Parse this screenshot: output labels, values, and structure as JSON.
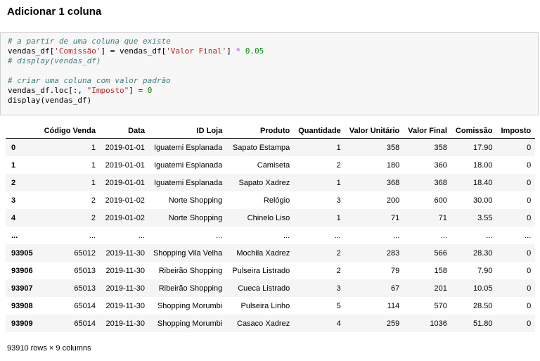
{
  "heading": "Adicionar 1 coluna",
  "code_lines": [
    {
      "type": "comment",
      "text": "# a partir de uma coluna que existe"
    },
    {
      "type": "code",
      "parts": [
        {
          "t": "plain",
          "v": "vendas_df["
        },
        {
          "t": "str",
          "v": "'Comissão'"
        },
        {
          "t": "plain",
          "v": "] = vendas_df["
        },
        {
          "t": "str",
          "v": "'Valor Final'"
        },
        {
          "t": "plain",
          "v": "] "
        },
        {
          "t": "op",
          "v": "*"
        },
        {
          "t": "plain",
          "v": " "
        },
        {
          "t": "num",
          "v": "0.05"
        }
      ]
    },
    {
      "type": "comment",
      "text": "# display(vendas_df)"
    },
    {
      "type": "blank",
      "text": ""
    },
    {
      "type": "comment",
      "text": "# criar uma coluna com valor padrão"
    },
    {
      "type": "code",
      "parts": [
        {
          "t": "plain",
          "v": "vendas_df.loc[:, "
        },
        {
          "t": "str",
          "v": "\"Imposto\""
        },
        {
          "t": "plain",
          "v": "] = "
        },
        {
          "t": "num",
          "v": "0"
        }
      ]
    },
    {
      "type": "code",
      "parts": [
        {
          "t": "plain",
          "v": "display(vendas_df)"
        }
      ]
    }
  ],
  "table": {
    "columns": [
      "",
      "Código Venda",
      "Data",
      "ID Loja",
      "Produto",
      "Quantidade",
      "Valor Unitário",
      "Valor Final",
      "Comissão",
      "Imposto"
    ],
    "rows": [
      [
        "0",
        "1",
        "2019-01-01",
        "Iguatemi Esplanada",
        "Sapato Estampa",
        "1",
        "358",
        "358",
        "17.90",
        "0"
      ],
      [
        "1",
        "1",
        "2019-01-01",
        "Iguatemi Esplanada",
        "Camiseta",
        "2",
        "180",
        "360",
        "18.00",
        "0"
      ],
      [
        "2",
        "1",
        "2019-01-01",
        "Iguatemi Esplanada",
        "Sapato Xadrez",
        "1",
        "368",
        "368",
        "18.40",
        "0"
      ],
      [
        "3",
        "2",
        "2019-01-02",
        "Norte Shopping",
        "Relógio",
        "3",
        "200",
        "600",
        "30.00",
        "0"
      ],
      [
        "4",
        "2",
        "2019-01-02",
        "Norte Shopping",
        "Chinelo Liso",
        "1",
        "71",
        "71",
        "3.55",
        "0"
      ],
      [
        "...",
        "...",
        "...",
        "...",
        "...",
        "...",
        "...",
        "...",
        "...",
        "..."
      ],
      [
        "93905",
        "65012",
        "2019-11-30",
        "Shopping Vila Velha",
        "Mochila Xadrez",
        "2",
        "283",
        "566",
        "28.30",
        "0"
      ],
      [
        "93906",
        "65013",
        "2019-11-30",
        "Ribeirão Shopping",
        "Pulseira Listrado",
        "2",
        "79",
        "158",
        "7.90",
        "0"
      ],
      [
        "93907",
        "65013",
        "2019-11-30",
        "Ribeirão Shopping",
        "Cueca Listrado",
        "3",
        "67",
        "201",
        "10.05",
        "0"
      ],
      [
        "93908",
        "65014",
        "2019-11-30",
        "Shopping Morumbi",
        "Pulseira Linho",
        "5",
        "114",
        "570",
        "28.50",
        "0"
      ],
      [
        "93909",
        "65014",
        "2019-11-30",
        "Shopping Morumbi",
        "Casaco Xadrez",
        "4",
        "259",
        "1036",
        "51.80",
        "0"
      ]
    ]
  },
  "footer": "93910 rows × 9 columns"
}
